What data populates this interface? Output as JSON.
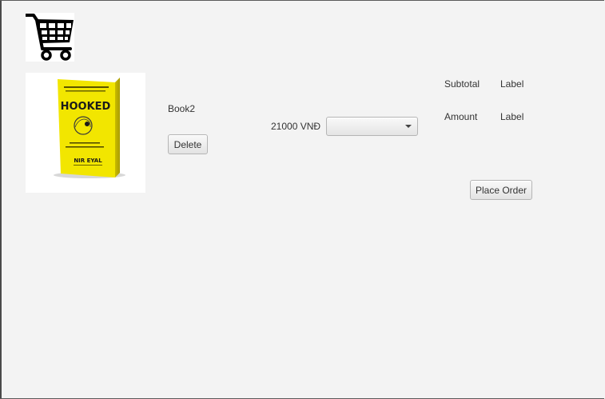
{
  "cart_icon": "shopping-cart-icon",
  "item": {
    "image_icon": "book-cover-hooked",
    "cover_title": "HOOKED",
    "cover_author": "NIR EYAL",
    "name": "Book2",
    "delete_label": "Delete",
    "price": "21000 VNĐ",
    "quantity_selected": ""
  },
  "summary": {
    "subtotal_label": "Subtotal",
    "subtotal_value": "Label",
    "amount_label": "Amount",
    "amount_value": "Label"
  },
  "place_order_label": "Place Order",
  "colors": {
    "background": "#f3f3f3",
    "book_cover": "#f2e600"
  }
}
